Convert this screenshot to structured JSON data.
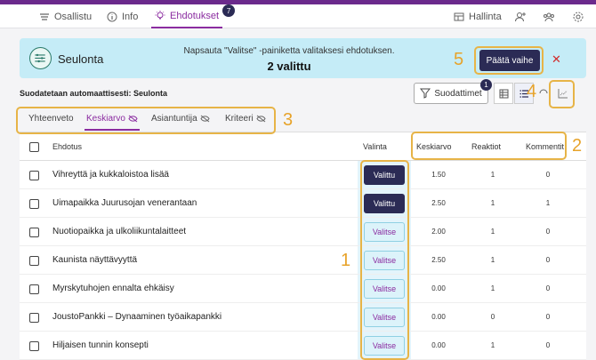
{
  "nav": {
    "tabs": [
      {
        "label": "Osallistu"
      },
      {
        "label": "Info"
      },
      {
        "label": "Ehdotukset",
        "badge": "7"
      }
    ],
    "manage_label": "Hallinta"
  },
  "banner": {
    "title": "Seulonta",
    "message": "Napsauta \"Valitse\" -painiketta valitaksesi ehdotuksen.",
    "count": "2 valittu",
    "decide_label": "Päätä vaihe"
  },
  "filter_line": "Suodatetaan automaattisesti: Seulonta",
  "filters_button": {
    "label": "Suodattimet",
    "badge": "1"
  },
  "tabs": [
    {
      "label": "Yhteenveto"
    },
    {
      "label": "Keskiarvo"
    },
    {
      "label": "Asiantuntija"
    },
    {
      "label": "Kriteeri"
    }
  ],
  "table": {
    "headers": {
      "title": "Ehdotus",
      "select": "Valinta",
      "avg": "Keskiarvo",
      "reactions": "Reaktiot",
      "comments": "Kommentit"
    },
    "rows": [
      {
        "title": "Vihreyttä ja kukkaloistoa lisää",
        "select": "Valittu",
        "avg": "1.50",
        "reactions": "1",
        "comments": "0"
      },
      {
        "title": "Uimapaikka Juurusojan venerantaan",
        "select": "Valittu",
        "avg": "2.50",
        "reactions": "1",
        "comments": "1"
      },
      {
        "title": "Nuotiopaikka ja ulkoliikuntalaitteet",
        "select": "Valitse",
        "avg": "2.00",
        "reactions": "1",
        "comments": "0"
      },
      {
        "title": "Kaunista näyttävyyttä",
        "select": "Valitse",
        "avg": "2.50",
        "reactions": "1",
        "comments": "0"
      },
      {
        "title": "Myrskytuhojen ennalta ehkäisy",
        "select": "Valitse",
        "avg": "0.00",
        "reactions": "1",
        "comments": "0"
      },
      {
        "title": "JoustoPankki – Dynaaminen työaikapankki",
        "select": "Valitse",
        "avg": "0.00",
        "reactions": "0",
        "comments": "0"
      },
      {
        "title": "Hiljaisen tunnin konsepti",
        "select": "Valitse",
        "avg": "0.00",
        "reactions": "1",
        "comments": "0"
      }
    ]
  },
  "annotations": [
    "1",
    "2",
    "3",
    "4",
    "5"
  ],
  "colors": {
    "accent": "#8b2ca0",
    "primary_button": "#2b2b55",
    "banner": "#c5ecf7",
    "annotation": "#e7b447",
    "close": "#d12b2b"
  }
}
